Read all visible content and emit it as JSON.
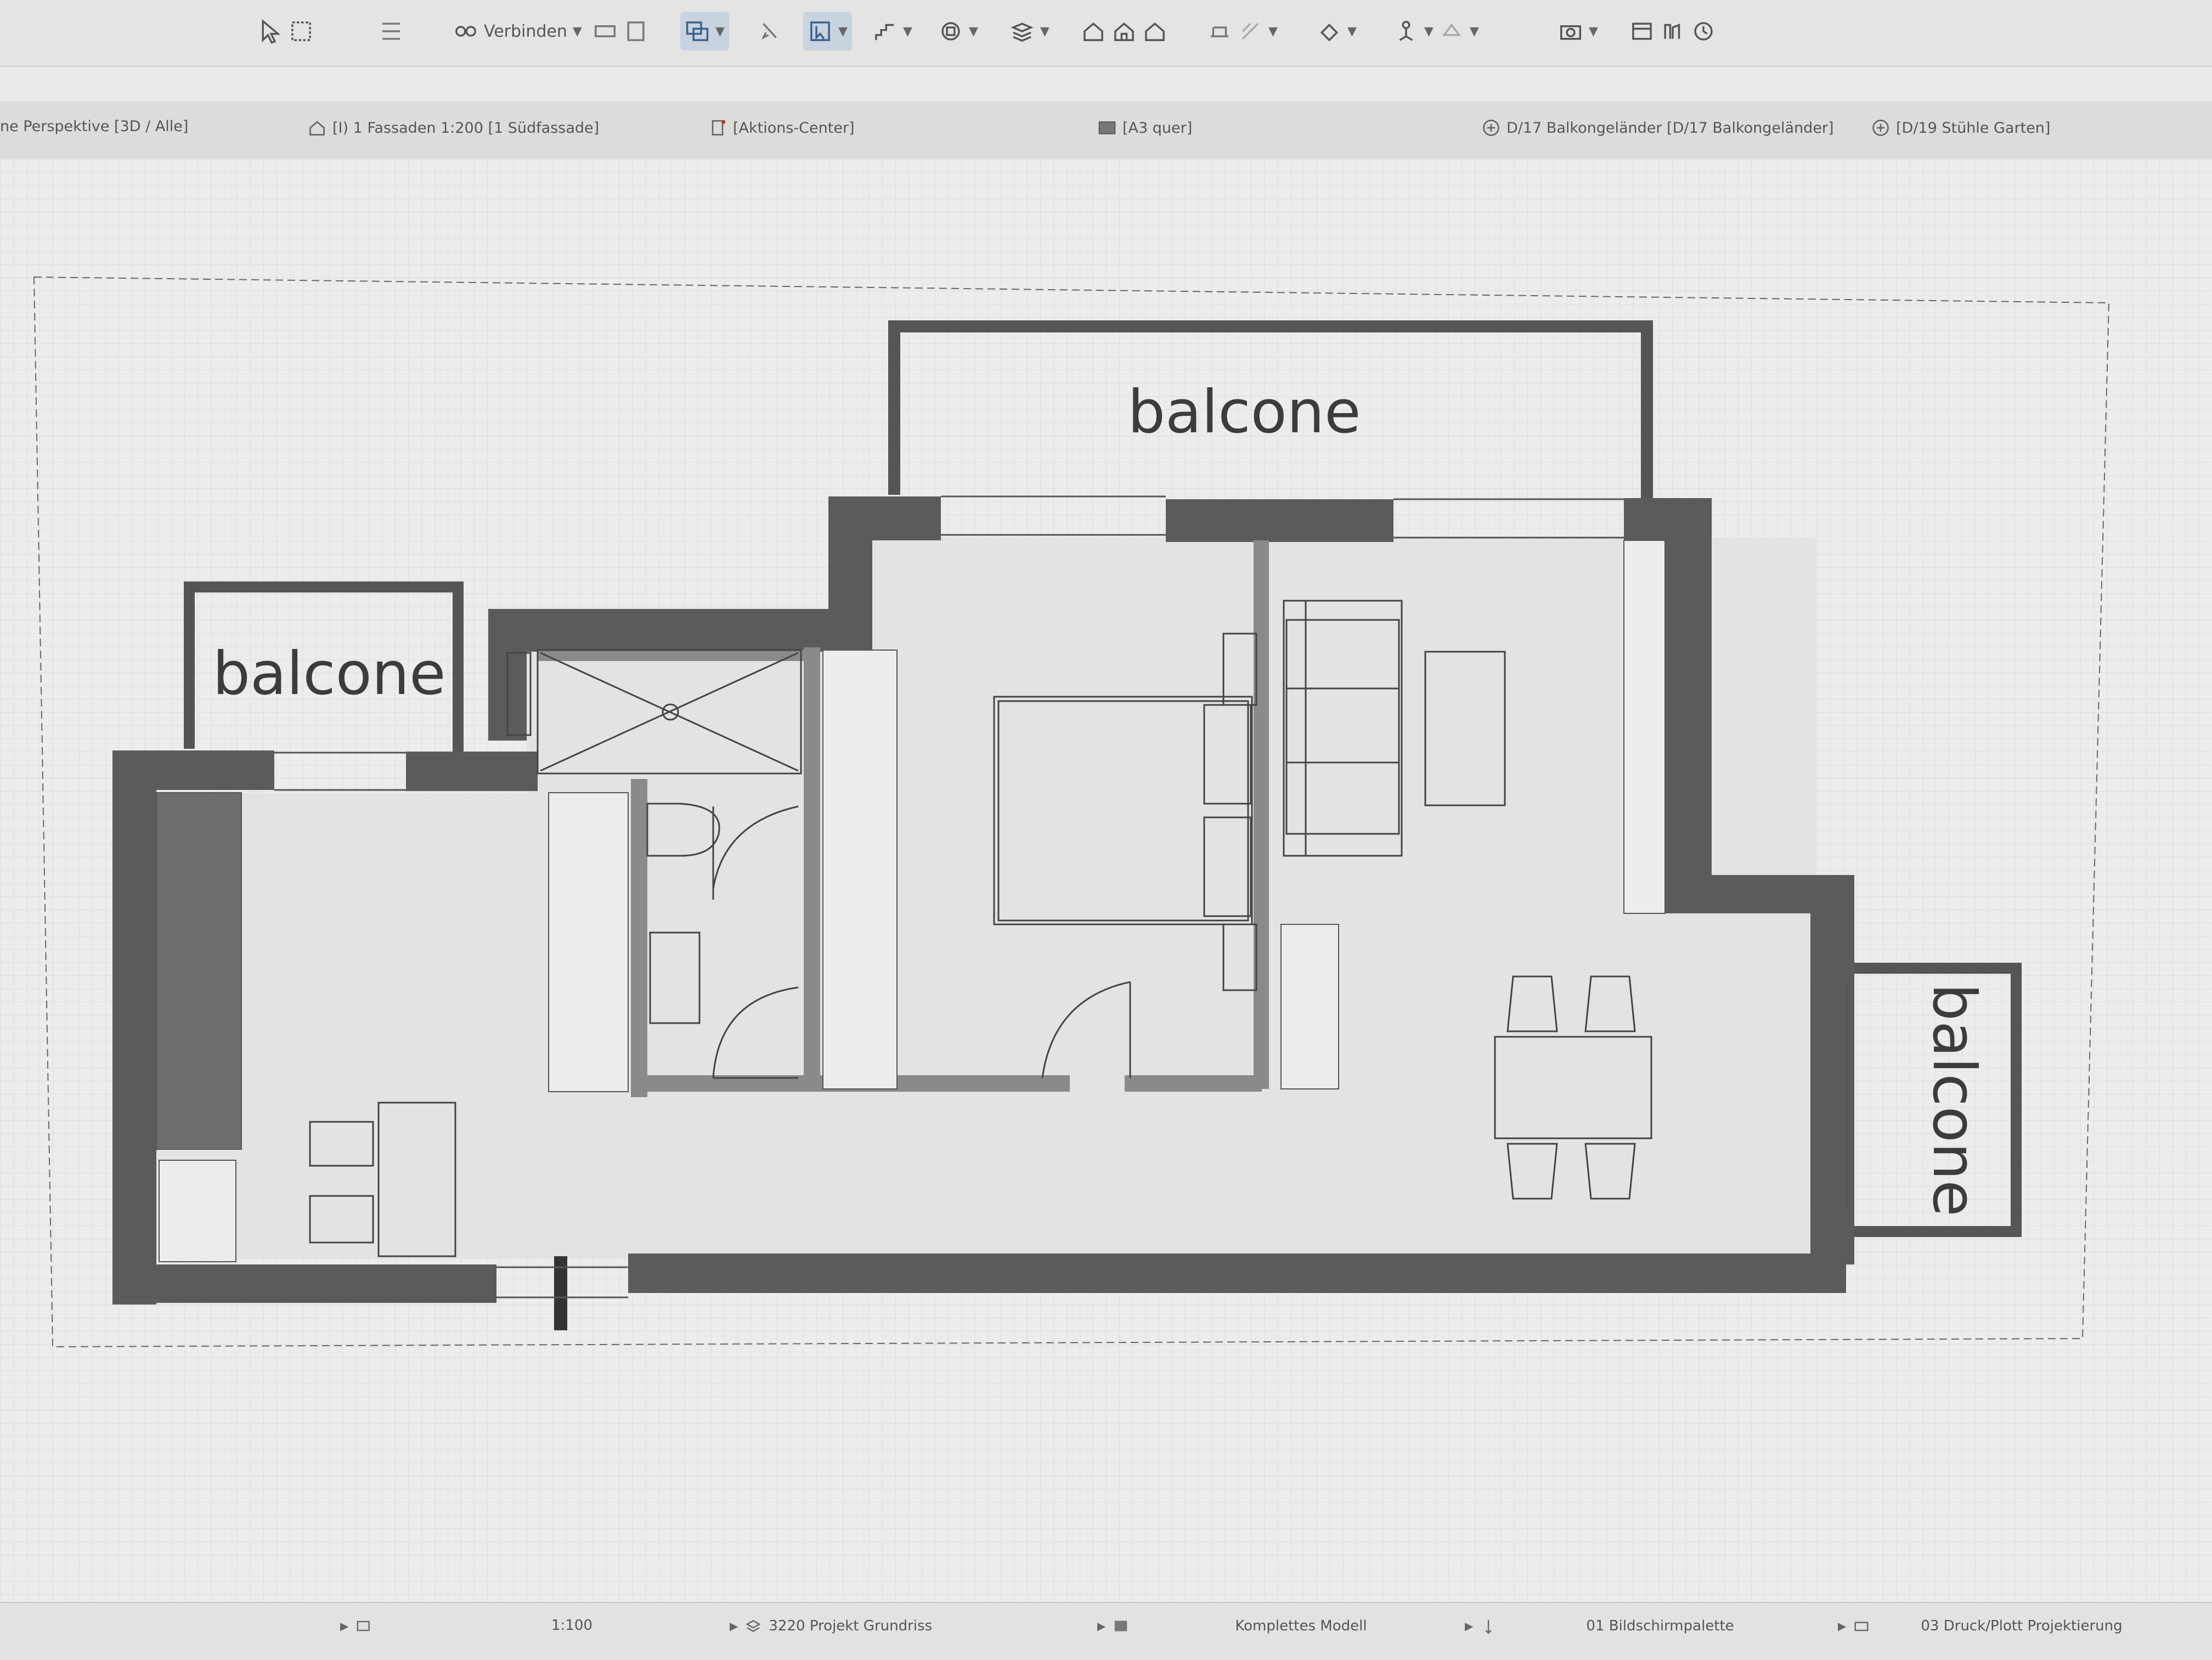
{
  "toolbar": {
    "connect_label": "Verbinden"
  },
  "tabs": [
    {
      "label": "ne Perspektive [3D / Alle]"
    },
    {
      "label": "[I) 1 Fassaden 1:200 [1 Südfassade]"
    },
    {
      "label": "[Aktions-Center]"
    },
    {
      "label": "[A3 quer]"
    },
    {
      "label": "D/17 Balkongeländer [D/17 Balkongeländer]"
    },
    {
      "label": "[D/19 Stühle Garten]"
    }
  ],
  "plan": {
    "balcony_top_label": "balcone",
    "balcony_left_label": "balcone",
    "balcony_right_label": "balcone"
  },
  "status": {
    "scale": "1:100",
    "view": "3220 Projekt Grundriss",
    "model": "Komplettes Modell",
    "palette": "01 Bildschirmpalette",
    "print": "03 Druck/Plott Projektierung"
  },
  "colors": {
    "wall": "#5b5b5b",
    "floor": "#e3e3e1",
    "line": "#444444"
  }
}
